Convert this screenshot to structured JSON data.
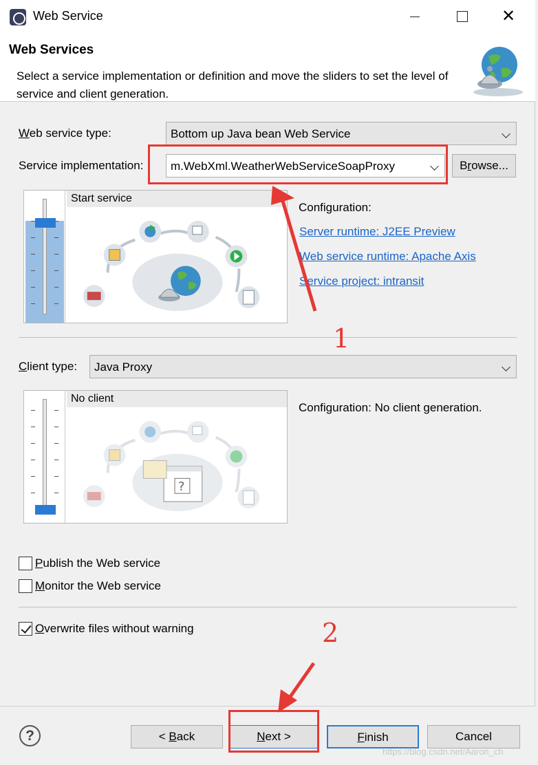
{
  "window": {
    "title": "Web Service"
  },
  "banner": {
    "title": "Web Services",
    "description": "Select a service implementation or definition and move the sliders to set the level of service and client generation."
  },
  "service": {
    "type_label_pre": "W",
    "type_label_post": "eb service type:",
    "type_value": "Bottom up Java bean Web Service",
    "impl_label": "Service implementation:",
    "impl_value": "m.WebXml.WeatherWebServiceSoapProxy",
    "browse_pre": "B",
    "browse_u": "r",
    "browse_post": "owse...",
    "slider_label": "Start service",
    "slider_level": "Start service",
    "config_title": "Configuration:",
    "links": [
      "Server runtime: J2EE Preview",
      "Web service runtime: Apache Axis",
      "Service project: intransit"
    ]
  },
  "client": {
    "type_label_pre": "C",
    "type_label_post": "lient type:",
    "type_value": "Java Proxy",
    "slider_label": "No client",
    "config_text": "Configuration: No client generation."
  },
  "options": {
    "publish": {
      "u": "P",
      "rest": "ublish the Web service",
      "checked": false
    },
    "monitor": {
      "u": "M",
      "rest": "onitor the Web service",
      "checked": false
    },
    "overwrite": {
      "u": "O",
      "rest": "verwrite files without warning",
      "checked": true
    }
  },
  "buttons": {
    "help": "?",
    "back_pre": "< ",
    "back_u": "B",
    "back_post": "ack",
    "next_u": "N",
    "next_post": "ext >",
    "finish_u": "F",
    "finish_post": "inish",
    "cancel": "Cancel"
  },
  "annotations": {
    "one": "1",
    "two": "2"
  },
  "watermark": "https://blog.csdn.net/Aaron_ch",
  "colors": {
    "annotation": "#e53935",
    "link": "#1a64c8",
    "slider": "#2a7bd3"
  }
}
